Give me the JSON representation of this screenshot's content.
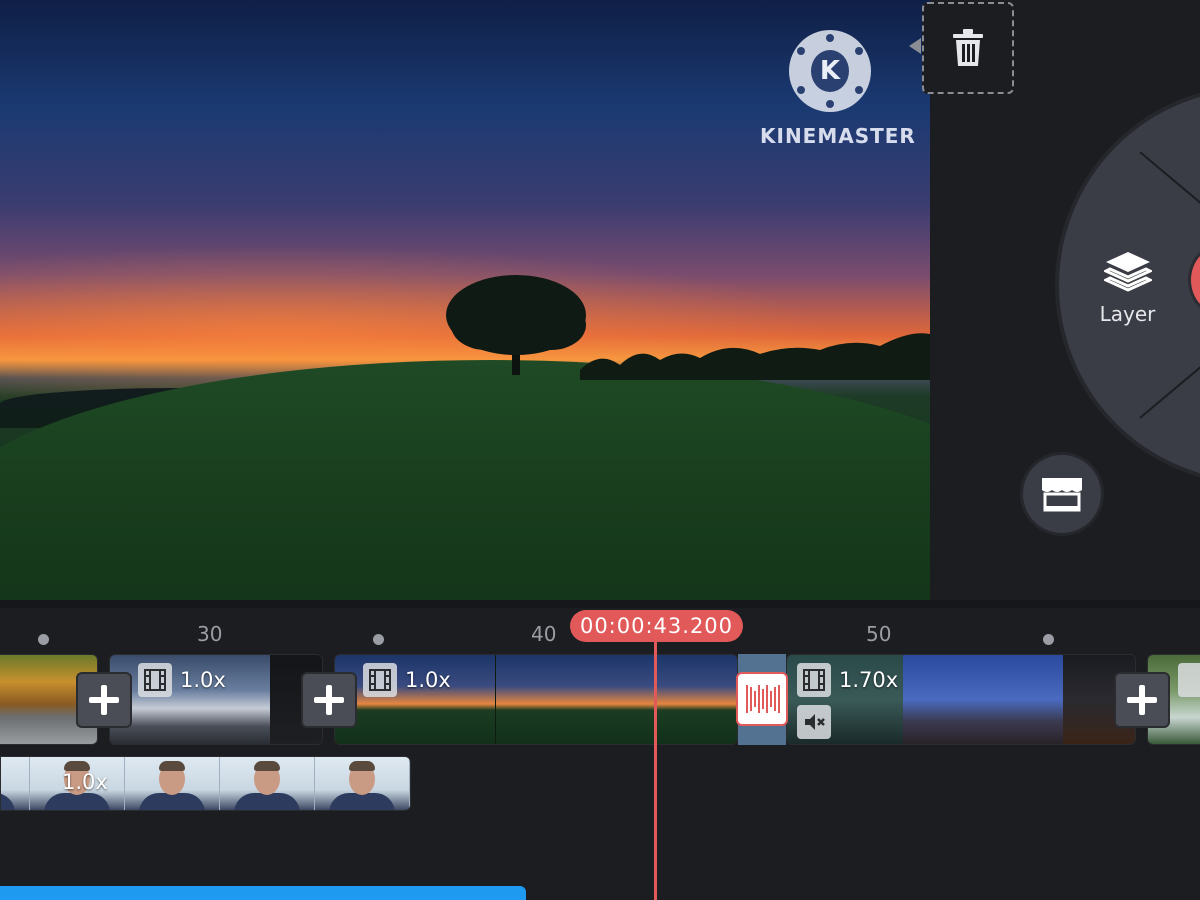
{
  "watermark": {
    "text": "KINEMASTER",
    "logo_letter": "K"
  },
  "panel": {
    "layer_label": "Layer",
    "trash_icon": "trash-icon",
    "store_icon": "store-icon"
  },
  "timeline": {
    "timecode": "00:00:43.200",
    "ruler_ticks": [
      "30",
      "40",
      "50"
    ],
    "clips": [
      {
        "speed": "1.0x"
      },
      {
        "speed": "1.0x"
      },
      {
        "speed": "1.70x"
      }
    ],
    "audio_clip_speed": "1.0x"
  },
  "colors": {
    "accent_red": "#e2595a",
    "accent_blue": "#1e9bf0",
    "background": "#1c1d20"
  }
}
